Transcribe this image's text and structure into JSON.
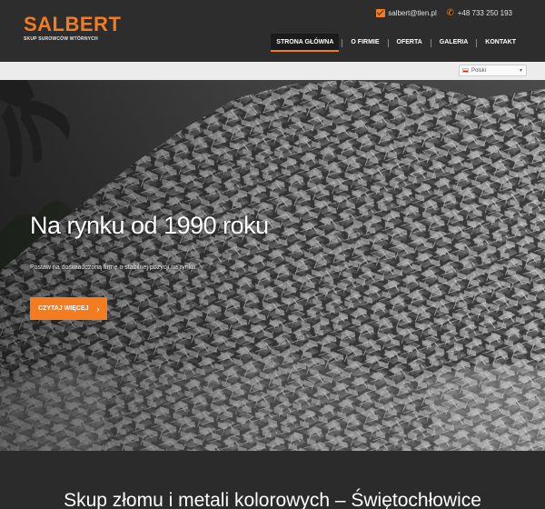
{
  "brand": {
    "name": "SALBERT",
    "tagline": "SKUP SUROWCÓW WTÓRNYCH"
  },
  "contact": {
    "email": "salbert@tlen.pl",
    "phone": "+48 733 250 193",
    "email_icon": "envelope-icon",
    "phone_icon": "phone-icon"
  },
  "nav": {
    "items": [
      {
        "label": "STRONA GŁÓWNA",
        "active": true
      },
      {
        "label": "O FIRMIE"
      },
      {
        "label": "OFERTA"
      },
      {
        "label": "GALERIA"
      },
      {
        "label": "KONTAKT"
      }
    ]
  },
  "language": {
    "selected": "Polski",
    "flag_icon": "poland-flag-icon"
  },
  "hero": {
    "title": "Na rynku od 1990 roku",
    "subtitle": "Postaw na doświadczoną firmę o stabilnej pozycji na rynku.",
    "button_label": "CZYTAJ WIĘCEJ",
    "button_icon": "chevron-right-icon"
  },
  "section": {
    "heading": "Skup złomu i metali kolorowych – Świętochłowice"
  },
  "colors": {
    "accent": "#f47c20",
    "header_bg": "#2d2d2d",
    "page_bg": "#2b2b2b",
    "lang_bar_bg": "#ececec"
  }
}
